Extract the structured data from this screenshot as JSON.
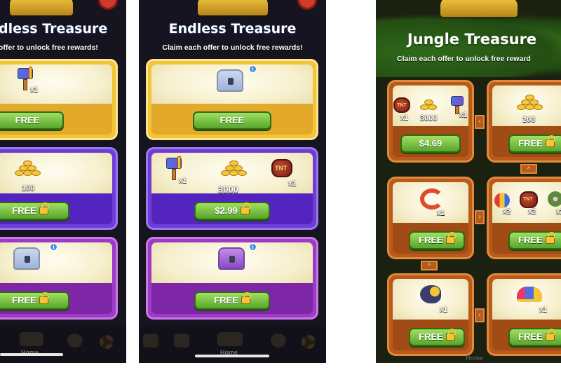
{
  "left": {
    "title": "dless Treasure",
    "subtitle": "offer to unlock free rewards!",
    "cards": [
      {
        "button": "FREE",
        "count": "x1"
      },
      {
        "button": "FREE",
        "amount": "100"
      },
      {
        "button": "FREE",
        "info": "i"
      }
    ],
    "nav": {
      "home_label": "Home"
    }
  },
  "middle": {
    "title": "Endless Treasure",
    "subtitle": "Claim each offer to unlock free rewards!",
    "cards": [
      {
        "button": "FREE",
        "info": "i"
      },
      {
        "button": "$2.99",
        "hammer_count": "x1",
        "amount": "3000",
        "tnt_count": "x1"
      },
      {
        "button": "FREE",
        "info": "i"
      }
    ],
    "nav": {
      "home_label": "Home"
    }
  },
  "right": {
    "title": "Jungle Treasure",
    "subtitle": "Claim each offer to unlock free reward",
    "cards": [
      {
        "button": "$4.69",
        "tnt_count": "x1",
        "amount": "3000",
        "hammer_count": "x1"
      },
      {
        "button": "FREE",
        "amount": "200"
      },
      {
        "button": "FREE",
        "count": "x1"
      },
      {
        "button": "FREE",
        "count_a": "x2",
        "count_b": "x2",
        "count_c": "x2"
      },
      {
        "button": "FREE",
        "count": "x1"
      },
      {
        "button": "FREE",
        "count": "x1"
      }
    ],
    "nav": {
      "home_label": "Home"
    }
  },
  "colors": {
    "gold_card": "#f3c43a",
    "purple_card": "#6d3ed6",
    "violet_card": "#9c3bc4",
    "wood_card": "#b85a1c",
    "button_green": "#59a52b"
  }
}
